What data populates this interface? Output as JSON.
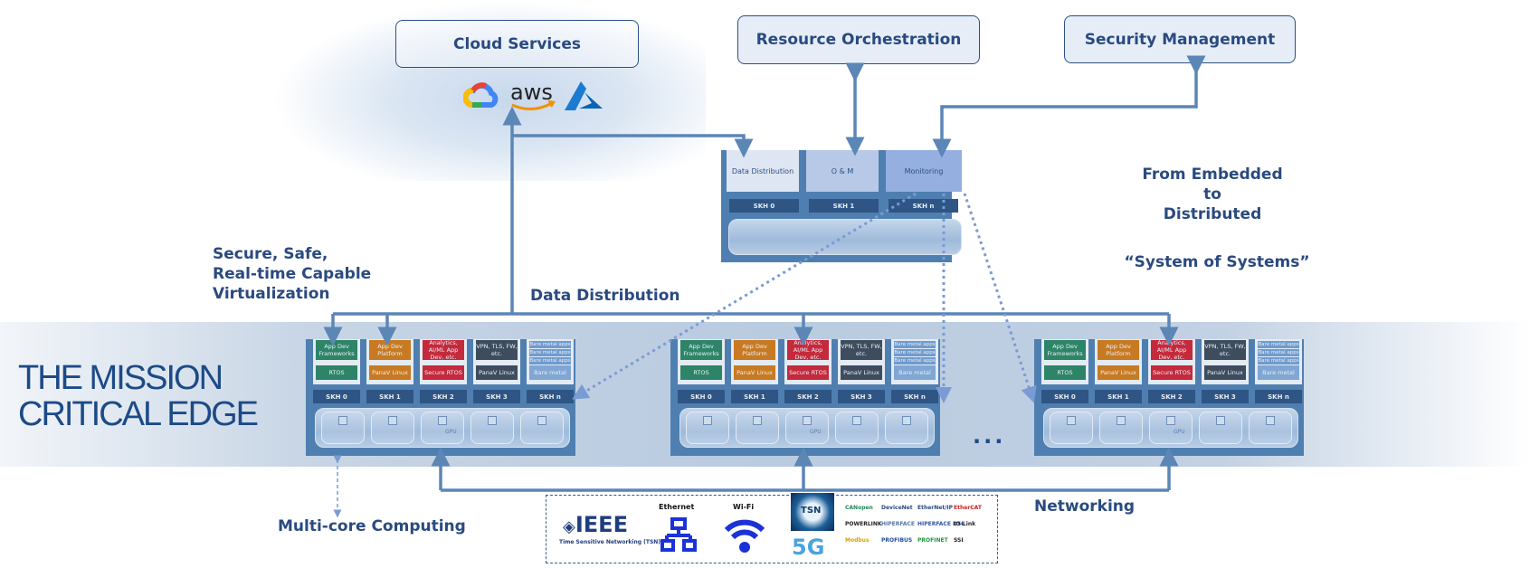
{
  "header_boxes": {
    "cloud_services": "Cloud Services",
    "resource_orchestration": "Resource Orchestration",
    "security_management": "Security Management"
  },
  "cloud_providers": [
    "Google Cloud",
    "aws",
    "Azure"
  ],
  "labels": {
    "virtualization": [
      "Secure, Safe,",
      "Real-time Capable",
      "Virtualization"
    ],
    "data_distribution": "Data Distribution",
    "from_embedded": [
      "From Embedded",
      "to",
      "Distributed"
    ],
    "system_of_systems": "“System of Systems”",
    "multi_core": "Multi-core Computing",
    "networking": "Networking",
    "ellipsis": "..."
  },
  "title": [
    "THE MISSION",
    "CRITICAL EDGE"
  ],
  "top_cluster": {
    "modules": [
      "Data Distribution",
      "O & M",
      "Monitoring"
    ],
    "skh": [
      "SKH 0",
      "SKH 1",
      "SKH n"
    ]
  },
  "edge_cluster": {
    "columns": [
      {
        "top": "App Dev Frameworks",
        "bottom": "RTOS",
        "color": "#2e8467"
      },
      {
        "top": "App Dev Platform",
        "bottom": "PanaV Linux",
        "color": "#c87a22"
      },
      {
        "top": "Analytics, AI/ML App Dev, etc.",
        "bottom": "Secure RTOS",
        "color": "#c42a3c"
      },
      {
        "top": "VPN, TLS, FW, etc.",
        "bottom": "PanaV Linux",
        "color": "#3e4d5e"
      },
      {
        "top": [
          "Bare metal apps",
          "Bare metal apps",
          "Bare metal apps"
        ],
        "bottom": "Bare metal",
        "color": "#6f9bcf"
      }
    ],
    "skh": [
      "SKH 0",
      "SKH 1",
      "SKH 2",
      "SKH 3",
      "SKH n"
    ],
    "hw_gpu_label": "GPU"
  },
  "networking_panel": {
    "ieee": "IEEE",
    "ieee_sub": "Time Sensitive Networking (TSN)",
    "ethernet": "Ethernet",
    "wifi": "Wi-Fi",
    "tsn": "TSN",
    "fiveg": "5G",
    "protocols": [
      "CANopen",
      "DeviceNet",
      "EtherNet/IP",
      "EtherCAT",
      "POWERLINK",
      "HIPERFACE",
      "HIPERFACE DSL",
      "IO-Link",
      "Modbus",
      "PROFIBUS",
      "PROFINET",
      "SSI"
    ]
  },
  "colors": {
    "arrow": "#5b86b6",
    "dotted": "#7b9bd4",
    "text": "#2a4a80"
  }
}
